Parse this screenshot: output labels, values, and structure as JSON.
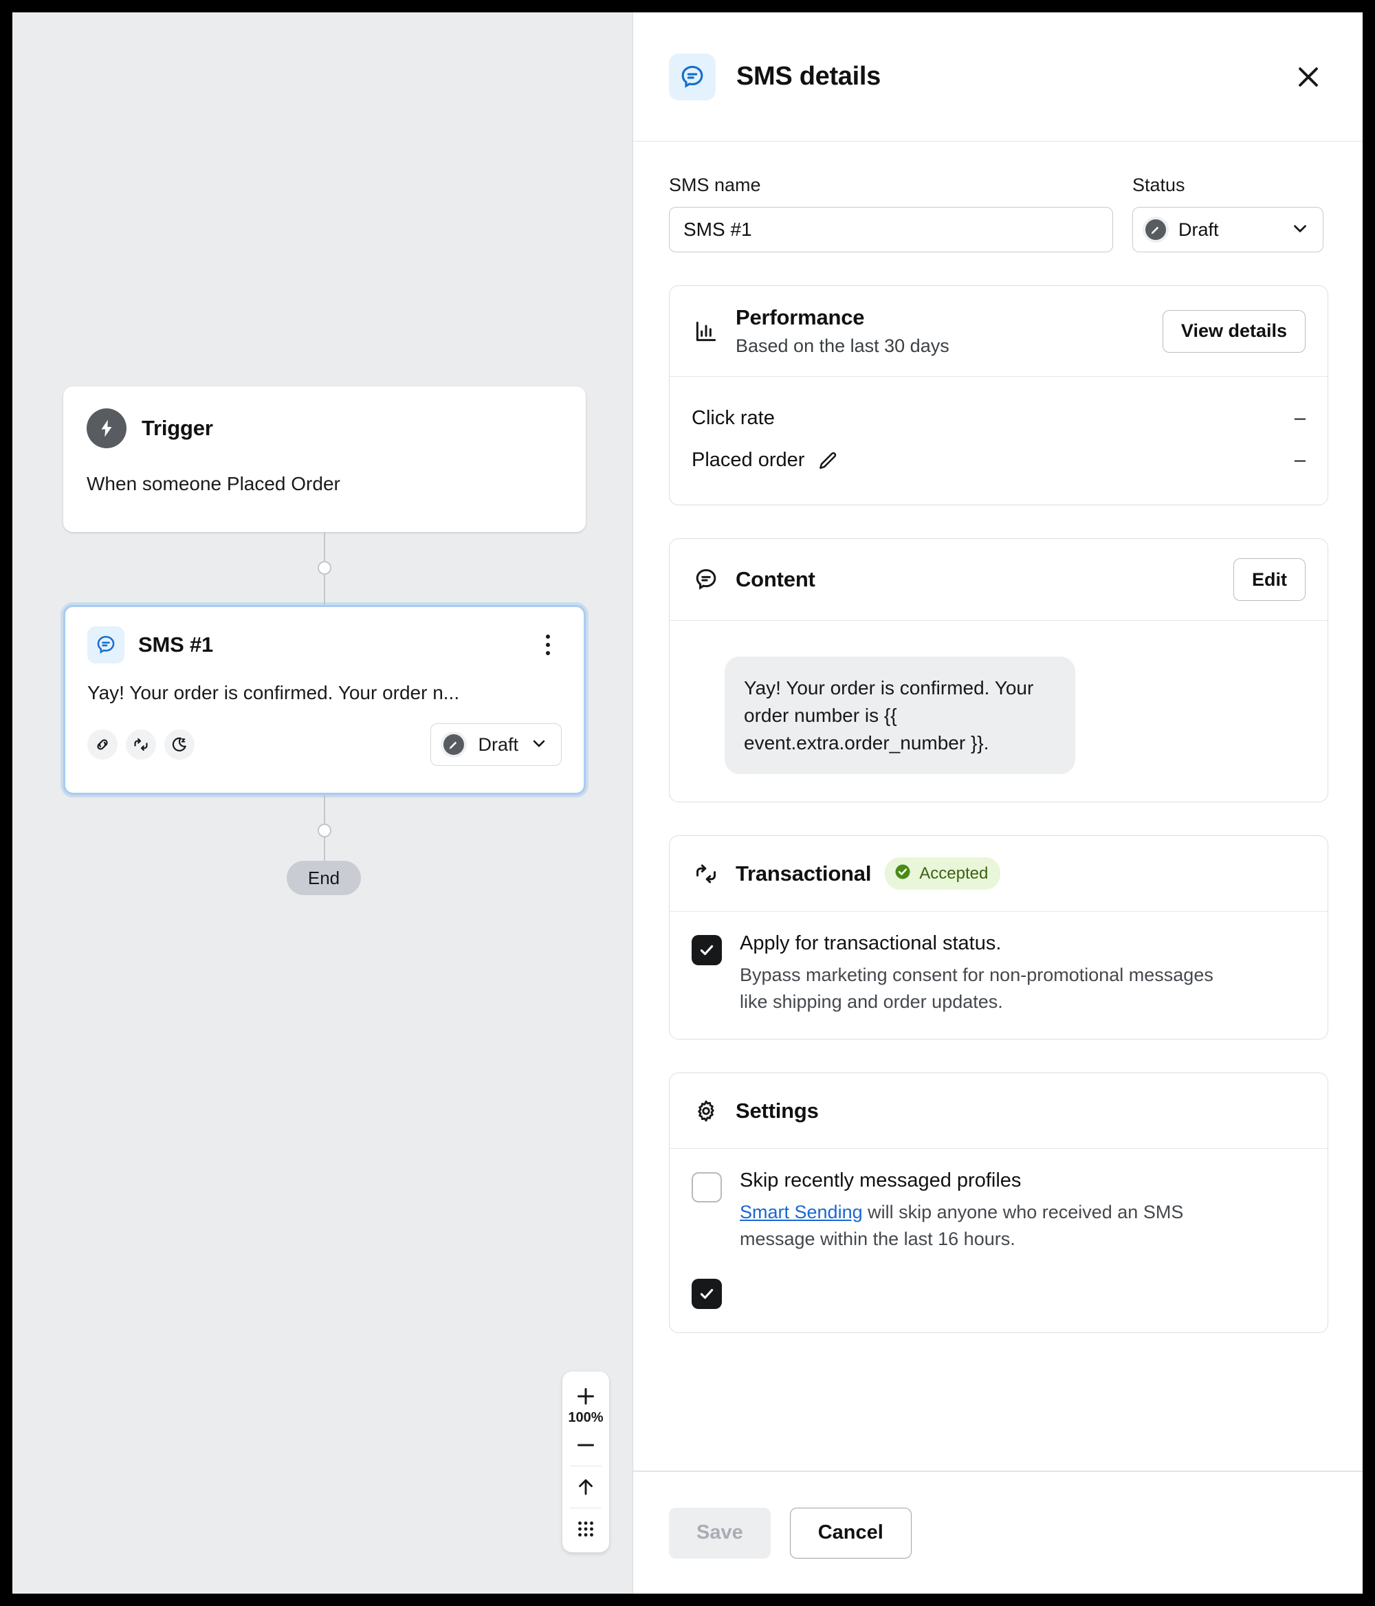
{
  "canvas": {
    "zoom_level": "100%",
    "trigger_node": {
      "icon": "lightning-bolt-icon",
      "title": "Trigger",
      "description": "When someone Placed Order"
    },
    "sms_node": {
      "icon": "sms-bubble-icon",
      "title": "SMS #1",
      "preview": "Yay! Your order is confirmed. Your order n...",
      "badges": [
        "link-icon",
        "transactional-sync-icon",
        "quiet-hours-moon-icon"
      ],
      "status": "Draft",
      "status_icon": "draft-pencil-icon"
    },
    "end_node": {
      "label": "End"
    },
    "zoom_controls": {
      "zoom_in": "plus-icon",
      "zoom_out": "minus-icon",
      "fit": "arrow-up-icon",
      "grid": "dot-grid-icon"
    }
  },
  "panel": {
    "header": {
      "icon": "sms-bubble-icon",
      "title": "SMS details",
      "close": "close-icon"
    },
    "sms_name": {
      "label": "SMS name",
      "value": "SMS #1",
      "placeholder": "SMS name"
    },
    "status": {
      "label": "Status",
      "value": "Draft",
      "icon": "draft-pencil-icon",
      "chevron": "chevron-down-icon"
    },
    "performance": {
      "icon": "bar-chart-icon",
      "title": "Performance",
      "subtitle": "Based on the last 30 days",
      "action_label": "View details",
      "metrics": [
        {
          "label": "Click rate",
          "value": "–",
          "has_edit": false
        },
        {
          "label": "Placed order",
          "value": "–",
          "has_edit": true,
          "edit_icon": "pencil-icon"
        }
      ]
    },
    "content": {
      "icon": "sms-bubble-outline-icon",
      "title": "Content",
      "action_label": "Edit",
      "message": "Yay! Your order is confirmed. Your order number is {{ event.extra.order_number }}."
    },
    "transactional": {
      "icon": "transactional-sync-icon",
      "title": "Transactional",
      "badge": {
        "text": "Accepted",
        "icon": "check-circle-icon",
        "bg": "#e9f6d9",
        "fg": "#3d6213"
      },
      "checkbox": {
        "checked": true,
        "label": "Apply for transactional status.",
        "description": "Bypass marketing consent for non-promotional messages like shipping and order updates."
      }
    },
    "settings": {
      "icon": "gear-icon",
      "title": "Settings",
      "options": [
        {
          "checked": false,
          "label": "Skip recently messaged profiles",
          "desc_link": "Smart Sending",
          "desc_rest": " will skip anyone who received an SMS message within the last 16 hours."
        }
      ]
    },
    "footer": {
      "save_label": "Save",
      "save_disabled": true,
      "cancel_label": "Cancel"
    }
  },
  "colors": {
    "accent_blue": "#1967d2",
    "canvas_bg": "#ebecee",
    "selected_border": "#a8cdf0",
    "badge_green_bg": "#e9f6d9",
    "badge_green_fg": "#3d6213"
  }
}
